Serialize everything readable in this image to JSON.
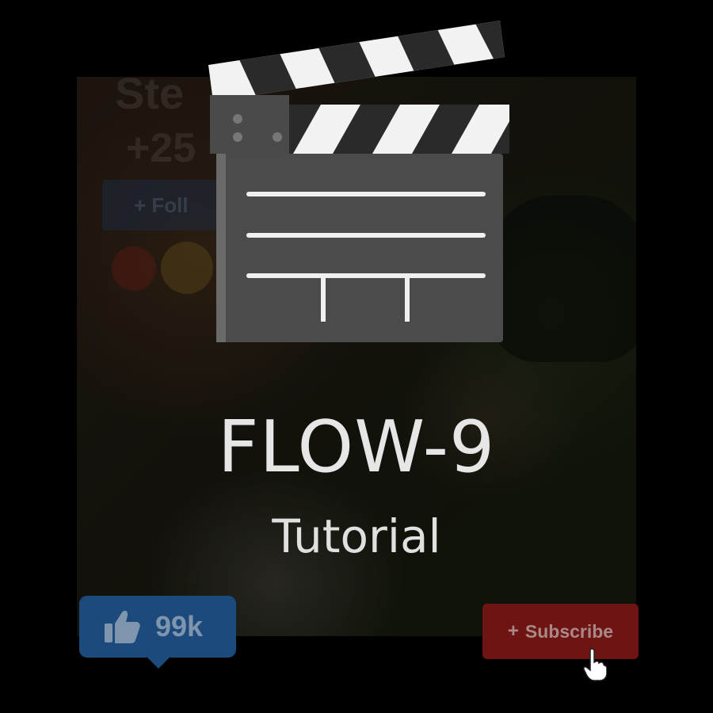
{
  "title": "FLOW-9",
  "subtitle": "Tutorial",
  "background_ghost": {
    "name_fragment": "Ste",
    "count_fragment": "+25",
    "follow_label": "+ Foll"
  },
  "like_button": {
    "icon": "thumbs-up-icon",
    "count": "99k",
    "color": "#1c4a7d"
  },
  "subscribe_button": {
    "icon": "plus-icon",
    "plus": "+",
    "label": "Subscribe",
    "color": "#6e1412"
  },
  "icons": {
    "logo": "clapperboard-icon",
    "cursor": "hand-pointer-icon"
  }
}
